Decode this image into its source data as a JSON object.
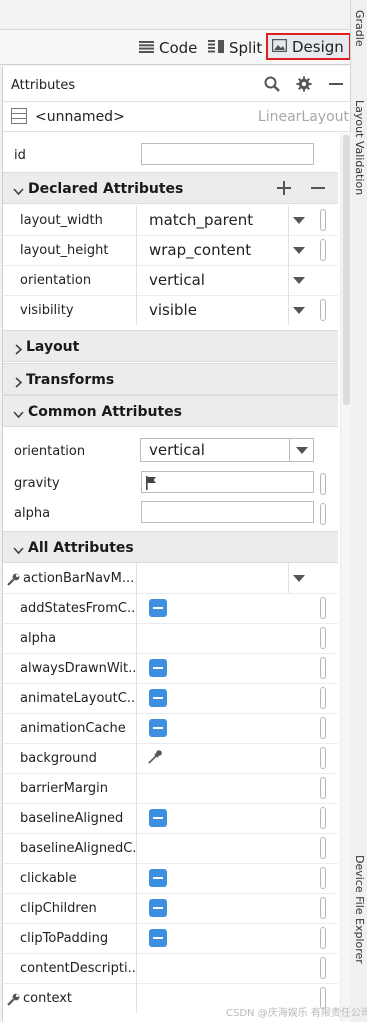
{
  "toolbar": {
    "modes": [
      {
        "label": "Code",
        "icon": "code-lines-icon"
      },
      {
        "label": "Split",
        "icon": "split-icon"
      },
      {
        "label": "Design",
        "icon": "image-icon",
        "selected": true
      }
    ],
    "highlight_color": "#e21d1d"
  },
  "side_tools": {
    "top_label": "Gradle",
    "layout_validation": "Layout Validation",
    "device_explorer": "Device File Explorer"
  },
  "panel": {
    "title": "Attributes",
    "icons": [
      "search-icon",
      "gear-icon",
      "minimize-icon"
    ],
    "component": {
      "name": "<unnamed>",
      "type": "LinearLayout"
    },
    "id_label": "id"
  },
  "declared": {
    "title": "Declared Attributes",
    "rows": [
      {
        "label": "layout_width",
        "value": "match_parent"
      },
      {
        "label": "layout_height",
        "value": "wrap_content"
      },
      {
        "label": "orientation",
        "value": "vertical"
      },
      {
        "label": "visibility",
        "value": "visible"
      }
    ]
  },
  "sections": {
    "layout": "Layout",
    "transforms": "Transforms",
    "common": "Common Attributes",
    "all": "All Attributes"
  },
  "common": {
    "orientation_label": "orientation",
    "orientation_value": "vertical",
    "gravity_label": "gravity",
    "alpha_label": "alpha"
  },
  "all_attrs": [
    {
      "label": "actionBarNavM...",
      "kind": "dropdown",
      "wrench": true
    },
    {
      "label": "addStatesFromC...",
      "kind": "toggle"
    },
    {
      "label": "alpha",
      "kind": "text"
    },
    {
      "label": "alwaysDrawnWit...",
      "kind": "toggle"
    },
    {
      "label": "animateLayoutC...",
      "kind": "toggle"
    },
    {
      "label": "animationCache",
      "kind": "toggle"
    },
    {
      "label": "background",
      "kind": "picker"
    },
    {
      "label": "barrierMargin",
      "kind": "text"
    },
    {
      "label": "baselineAligned",
      "kind": "toggle"
    },
    {
      "label": "baselineAlignedC...",
      "kind": "text"
    },
    {
      "label": "clickable",
      "kind": "toggle"
    },
    {
      "label": "clipChildren",
      "kind": "toggle"
    },
    {
      "label": "clipToPadding",
      "kind": "toggle"
    },
    {
      "label": "contentDescripti...",
      "kind": "text"
    },
    {
      "label": "context",
      "kind": "text",
      "wrench": true
    }
  ],
  "watermark": "CSDN @庆海娱乐 有限责任公司",
  "colors": {
    "toggle_blue": "#3d8fe0",
    "section_bg": "#ececec"
  }
}
